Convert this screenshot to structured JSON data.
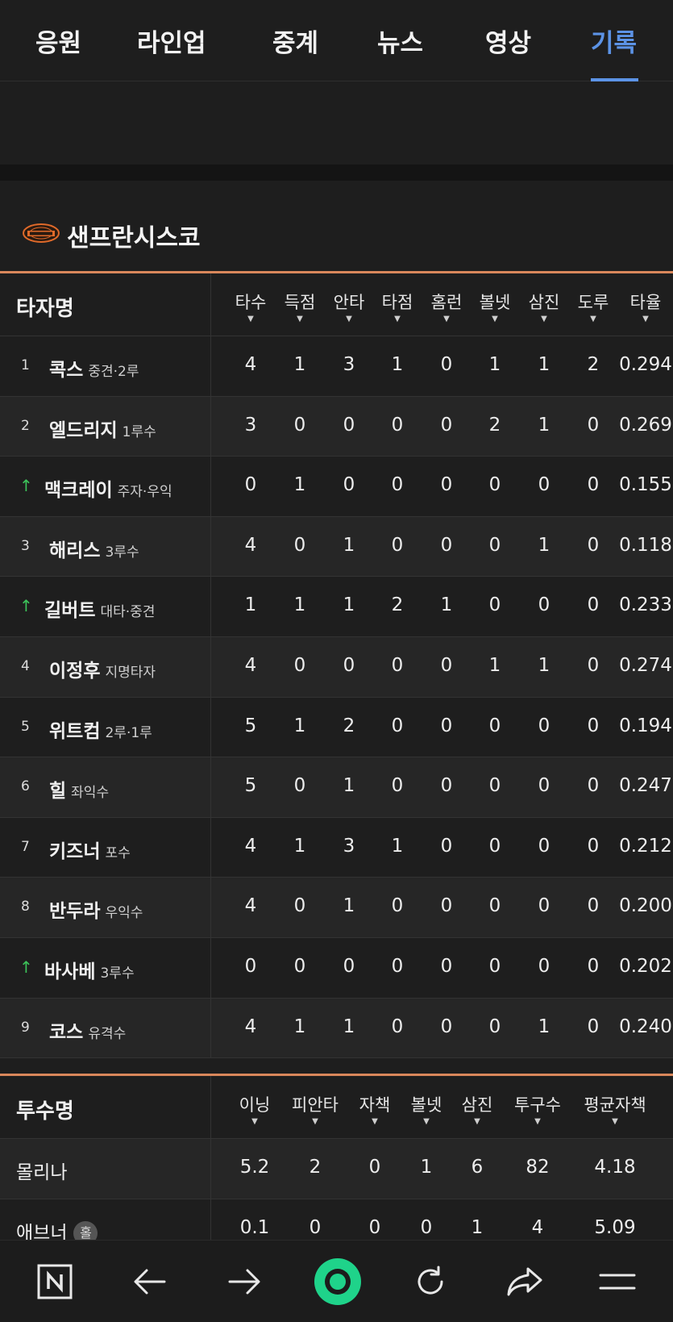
{
  "tabs": [
    "응원",
    "라인업",
    "중계",
    "뉴스",
    "영상",
    "기록"
  ],
  "active_tab": "기록",
  "team": {
    "name": "샌프란시스코",
    "logo_icon": "giants-logo-icon"
  },
  "batting": {
    "header_title": "타자명",
    "columns": [
      "타수",
      "득점",
      "안타",
      "타점",
      "홈런",
      "볼넷",
      "삼진",
      "도루",
      "타율"
    ],
    "rows": [
      {
        "order": "1",
        "sub": false,
        "name": "콕스",
        "pos": "중견·2루",
        "stats": [
          "4",
          "1",
          "3",
          "1",
          "0",
          "1",
          "1",
          "2",
          "0.294"
        ]
      },
      {
        "order": "2",
        "sub": false,
        "name": "엘드리지",
        "pos": "1루수",
        "stats": [
          "3",
          "0",
          "0",
          "0",
          "0",
          "2",
          "1",
          "0",
          "0.269"
        ]
      },
      {
        "order": "",
        "sub": true,
        "name": "맥크레이",
        "pos": "주자·우익",
        "stats": [
          "0",
          "1",
          "0",
          "0",
          "0",
          "0",
          "0",
          "0",
          "0.155"
        ]
      },
      {
        "order": "3",
        "sub": false,
        "name": "해리스",
        "pos": "3루수",
        "stats": [
          "4",
          "0",
          "1",
          "0",
          "0",
          "0",
          "1",
          "0",
          "0.118"
        ]
      },
      {
        "order": "",
        "sub": true,
        "name": "길버트",
        "pos": "대타·중견",
        "stats": [
          "1",
          "1",
          "1",
          "2",
          "1",
          "0",
          "0",
          "0",
          "0.233"
        ]
      },
      {
        "order": "4",
        "sub": false,
        "name": "이정후",
        "pos": "지명타자",
        "stats": [
          "4",
          "0",
          "0",
          "0",
          "0",
          "1",
          "1",
          "0",
          "0.274"
        ]
      },
      {
        "order": "5",
        "sub": false,
        "name": "위트컴",
        "pos": "2루·1루",
        "stats": [
          "5",
          "1",
          "2",
          "0",
          "0",
          "0",
          "0",
          "0",
          "0.194"
        ]
      },
      {
        "order": "6",
        "sub": false,
        "name": "힐",
        "pos": "좌익수",
        "stats": [
          "5",
          "0",
          "1",
          "0",
          "0",
          "0",
          "0",
          "0",
          "0.247"
        ]
      },
      {
        "order": "7",
        "sub": false,
        "name": "키즈너",
        "pos": "포수",
        "stats": [
          "4",
          "1",
          "3",
          "1",
          "0",
          "0",
          "0",
          "0",
          "0.212"
        ]
      },
      {
        "order": "8",
        "sub": false,
        "name": "반두라",
        "pos": "우익수",
        "stats": [
          "4",
          "0",
          "1",
          "0",
          "0",
          "0",
          "0",
          "0",
          "0.200"
        ]
      },
      {
        "order": "",
        "sub": true,
        "name": "바사베",
        "pos": "3루수",
        "stats": [
          "0",
          "0",
          "0",
          "0",
          "0",
          "0",
          "0",
          "0",
          "0.202"
        ]
      },
      {
        "order": "9",
        "sub": false,
        "name": "코스",
        "pos": "유격수",
        "stats": [
          "4",
          "1",
          "1",
          "0",
          "0",
          "0",
          "1",
          "0",
          "0.240"
        ]
      }
    ]
  },
  "pitching": {
    "header_title": "투수명",
    "columns": [
      "이닝",
      "피안타",
      "자책",
      "볼넷",
      "삼진",
      "투구수",
      "평균자책"
    ],
    "rows": [
      {
        "name": "몰리나",
        "badge": "",
        "stats": [
          "5.2",
          "2",
          "0",
          "1",
          "6",
          "82",
          "4.18"
        ]
      },
      {
        "name": "애브너",
        "badge": "홀",
        "stats": [
          "0.1",
          "0",
          "0",
          "0",
          "1",
          "4",
          "5.09"
        ]
      }
    ]
  },
  "bottom_bar": [
    "naver-n-icon",
    "back-arrow-icon",
    "forward-arrow-icon",
    "green-dot-icon",
    "refresh-icon",
    "share-icon",
    "menu-icon"
  ],
  "colors": {
    "accent_blue": "#5c93e6",
    "divider_orange": "#d9875b",
    "sub_arrow_green": "#3cc45a",
    "bottom_green": "#1fd38a"
  }
}
